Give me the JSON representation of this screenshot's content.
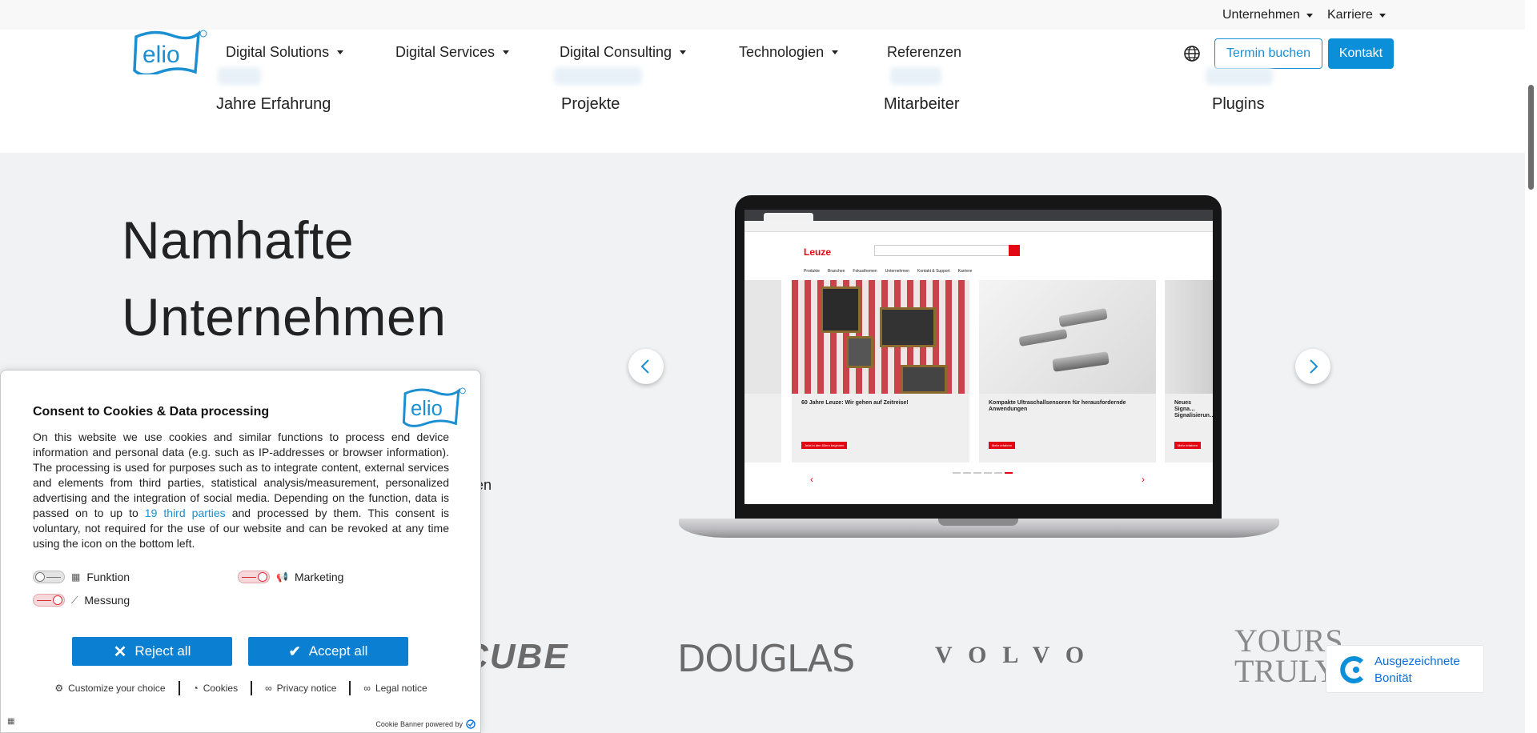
{
  "topbar": {
    "unternehmen": "Unternehmen",
    "karriere": "Karriere"
  },
  "nav": {
    "items": [
      {
        "label": "Digital Solutions",
        "dropdown": true
      },
      {
        "label": "Digital Services",
        "dropdown": true
      },
      {
        "label": "Digital Consulting",
        "dropdown": true
      },
      {
        "label": "Technologien",
        "dropdown": true
      },
      {
        "label": "Referenzen",
        "dropdown": false
      }
    ],
    "language_icon": "globe-icon",
    "termin_label": "Termin buchen",
    "kontakt_label": "Kontakt"
  },
  "stats": [
    {
      "label": "Jahre Erfahrung"
    },
    {
      "label": "Projekte"
    },
    {
      "label": "Mitarbeiter"
    },
    {
      "label": "Plugins"
    }
  ],
  "section": {
    "headline_line1": "Namhafte",
    "headline_line2": "Unternehmen",
    "partial_text": "en"
  },
  "laptop_screen": {
    "brand": "Leuze",
    "menu": [
      "Produkte",
      "Branchen",
      "Fokusthemen",
      "Unternehmen",
      "Kontakt & Support",
      "Karriere"
    ],
    "cards": [
      {
        "title": "60 Jahre Leuze: Wir gehen auf Zeitreise!",
        "button": "Jetzt in den 60ern beginnen"
      },
      {
        "title": "Kompakte Ultraschallsensoren für herausfordernde Anwendungen",
        "button": "Mehr erfahren"
      },
      {
        "title": "Neues Signa… Signalisierun…",
        "button": "Mehr erfahren"
      }
    ]
  },
  "logos": [
    "CUBE",
    "DOUGLAS",
    "VOLVO",
    "YOURS TRULY"
  ],
  "rating": {
    "line1": "Ausgezeichnete",
    "line2": "Bonität"
  },
  "cookie": {
    "title": "Consent to Cookies & Data processing",
    "body_before_link": "On this website we use cookies and similar functions to process end device information and personal data (e.g. such as IP-addresses or browser information). The processing is used for purposes such as to integrate content, external services and elements from third parties, statistical analysis/measurement, personalized advertising and the integration of social media. Depending on the function, data is passed on to up to ",
    "body_link": "19 third parties",
    "body_after_link": " and processed by them. This consent is voluntary, not required for the use of our website and can be revoked at any time using the icon on the bottom left.",
    "toggles": [
      {
        "label": "Funktion",
        "icon": "grid-icon",
        "enabled": false
      },
      {
        "label": "Marketing",
        "icon": "megaphone-icon",
        "enabled": false
      },
      {
        "label": "Messung",
        "icon": "chart-icon",
        "enabled": false
      }
    ],
    "reject_label": "Reject all",
    "accept_label": "Accept all",
    "links": [
      "Customize your choice",
      "Cookies",
      "Privacy notice",
      "Legal notice"
    ],
    "powered_by": "Cookie Banner powered by"
  },
  "colors": {
    "brand_blue": "#0b8fd8",
    "leuze_red": "#e30613",
    "rating_blue": "#0b6fd8"
  }
}
